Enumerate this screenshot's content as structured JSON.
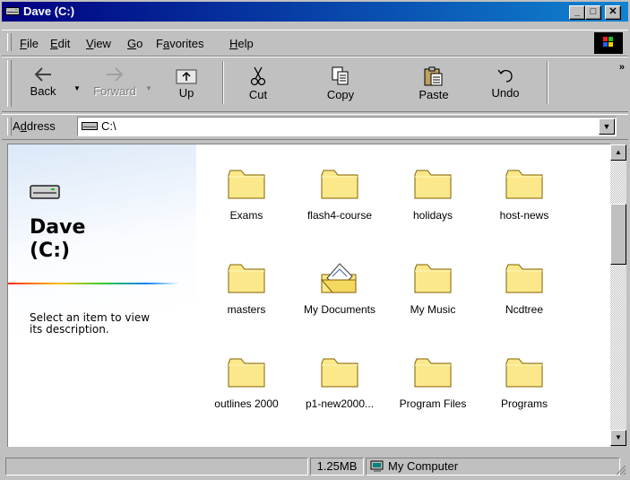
{
  "window": {
    "title": "Dave (C:)",
    "title_icon": "drive-icon",
    "controls": {
      "minimize": "_",
      "maximize": "□",
      "close": "✕"
    }
  },
  "menubar": {
    "items": [
      {
        "label": "File",
        "mnemonic": "F",
        "rest": "ile"
      },
      {
        "label": "Edit",
        "mnemonic": "E",
        "rest": "dit"
      },
      {
        "label": "View",
        "mnemonic": "V",
        "rest": "iew"
      },
      {
        "label": "Go",
        "mnemonic": "G",
        "rest": "o"
      },
      {
        "label": "Favorites",
        "mnemonic": "a",
        "pre": "F",
        "rest": "vorites"
      },
      {
        "label": "Help",
        "mnemonic": "H",
        "rest": "elp"
      }
    ]
  },
  "toolbar": {
    "back": "Back",
    "forward": "Forward",
    "up": "Up",
    "cut": "Cut",
    "copy": "Copy",
    "paste": "Paste",
    "undo": "Undo",
    "more": "»"
  },
  "address": {
    "label": "Address",
    "mnemonic": "d",
    "value": "C:\\"
  },
  "left_panel": {
    "drive_title_line1": "Dave",
    "drive_title_line2": "(C:)",
    "description": "Select an item to view its description."
  },
  "items": [
    {
      "name": "Exams",
      "icon": "folder-icon"
    },
    {
      "name": "flash4-course",
      "icon": "folder-icon"
    },
    {
      "name": "holidays",
      "icon": "folder-icon"
    },
    {
      "name": "host-news",
      "icon": "folder-icon"
    },
    {
      "name": "masters",
      "icon": "folder-icon"
    },
    {
      "name": "My Documents",
      "icon": "my-documents-icon"
    },
    {
      "name": "My Music",
      "icon": "folder-icon"
    },
    {
      "name": "Ncdtree",
      "icon": "folder-icon"
    },
    {
      "name": "outlines 2000",
      "icon": "folder-icon"
    },
    {
      "name": "p1-new2000...",
      "icon": "folder-icon"
    },
    {
      "name": "Program Files",
      "icon": "folder-icon"
    },
    {
      "name": "Programs",
      "icon": "folder-icon"
    }
  ],
  "statusbar": {
    "size": "1.25MB",
    "zone": "My Computer"
  },
  "colors": {
    "titlebar_start": "#000080",
    "titlebar_end": "#1084d0",
    "folder_fill": "#fbe88a",
    "chrome": "#c0c0c0"
  }
}
